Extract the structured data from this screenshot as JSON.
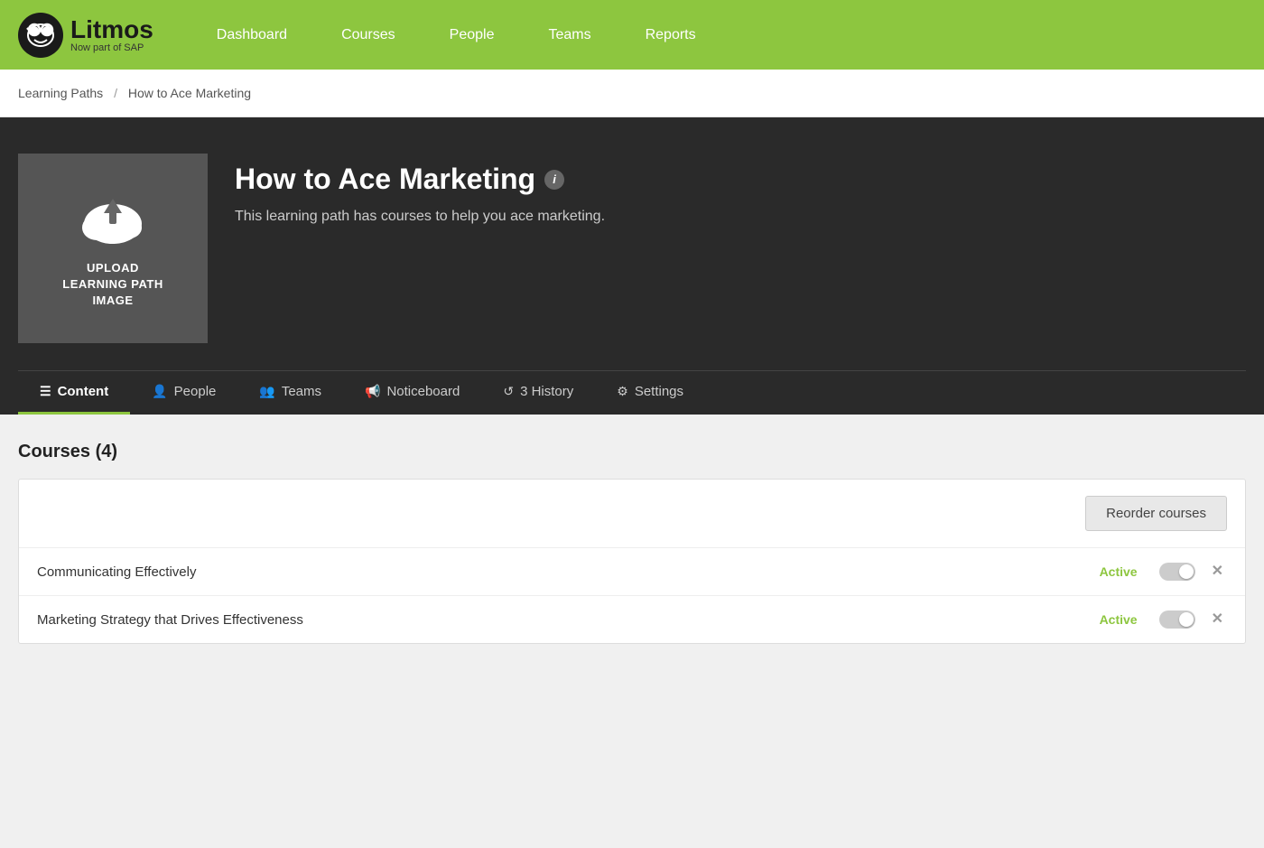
{
  "navbar": {
    "brand_name": "Litmos",
    "brand_sub": "Now part of SAP",
    "nav_items": [
      {
        "label": "Dashboard",
        "href": "#"
      },
      {
        "label": "Courses",
        "href": "#"
      },
      {
        "label": "People",
        "href": "#"
      },
      {
        "label": "Teams",
        "href": "#"
      },
      {
        "label": "Reports",
        "href": "#"
      }
    ]
  },
  "breadcrumb": {
    "parent": "Learning Paths",
    "separator": "/",
    "current": "How to Ace Marketing"
  },
  "hero": {
    "upload_label": "UPLOAD\nLEARNING PATH\nIMAGE",
    "title": "How to Ace Marketing",
    "description": "This learning path has courses to help you ace marketing.",
    "info_icon": "i"
  },
  "tabs": [
    {
      "id": "content",
      "label": "Content",
      "icon": "☰",
      "active": true
    },
    {
      "id": "people",
      "label": "People",
      "icon": "👤",
      "active": false
    },
    {
      "id": "teams",
      "label": "Teams",
      "icon": "👥",
      "active": false
    },
    {
      "id": "noticeboard",
      "label": "Noticeboard",
      "icon": "📢",
      "active": false
    },
    {
      "id": "history",
      "label": "3 History",
      "icon": "↺",
      "active": false
    },
    {
      "id": "settings",
      "label": "Settings",
      "icon": "⚙",
      "active": false
    }
  ],
  "content": {
    "section_title": "Courses (4)",
    "reorder_button": "Reorder courses",
    "courses": [
      {
        "name": "Communicating Effectively",
        "status": "Active"
      },
      {
        "name": "Marketing Strategy that Drives Effectiveness",
        "status": "Active"
      }
    ]
  }
}
